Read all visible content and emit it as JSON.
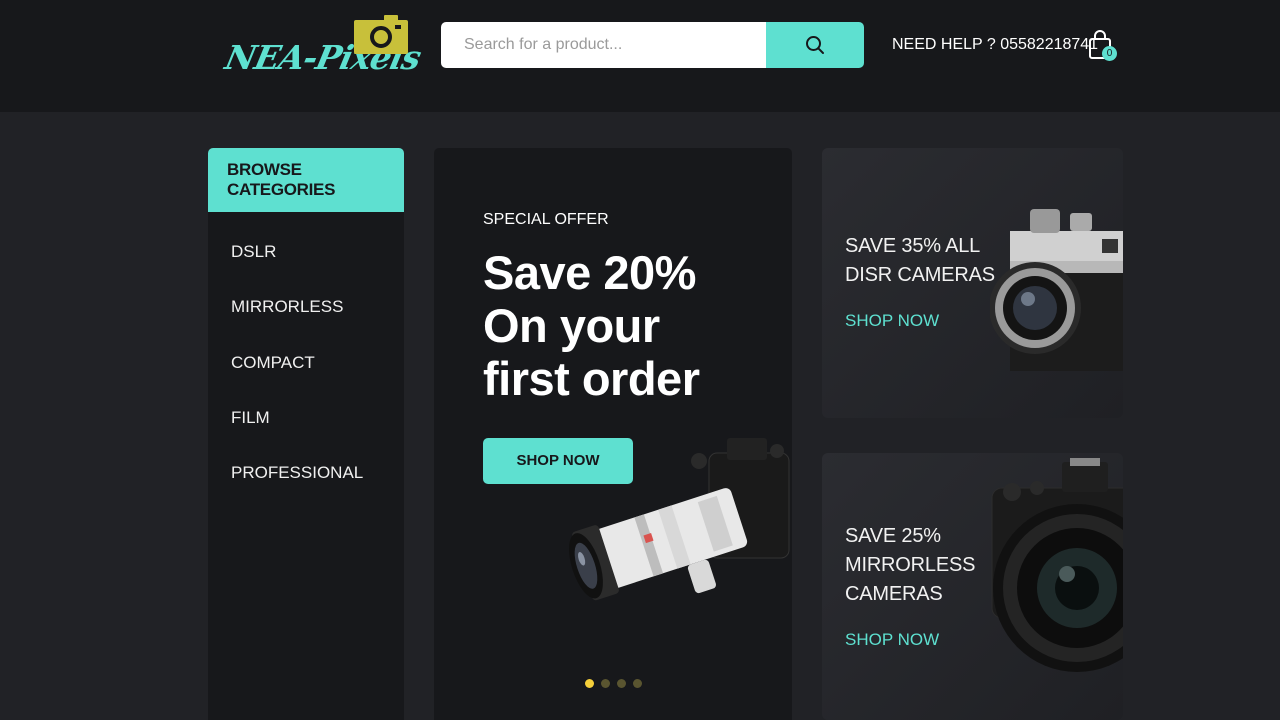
{
  "header": {
    "logo_text": "NEA-Pixels",
    "search": {
      "placeholder": "Search for a product..."
    },
    "help_text": "NEED HELP ? 05582218741",
    "cart_count": "0"
  },
  "sidebar": {
    "title": "BROWSE CATEGORIES",
    "items": [
      {
        "label": "DSLR"
      },
      {
        "label": "MIRRORLESS"
      },
      {
        "label": "COMPACT"
      },
      {
        "label": "FILM"
      },
      {
        "label": "PROFESSIONAL"
      }
    ]
  },
  "hero": {
    "kicker": "SPECIAL OFFER",
    "title_line1": "Save 20%",
    "title_line2": "On your",
    "title_line3": "first order",
    "button_label": "SHOP NOW",
    "slides_total": 4,
    "active_slide": 1
  },
  "promos": [
    {
      "title_line1": "SAVE 35% ALL",
      "title_line2": "DISR CAMERAS",
      "link_label": "SHOP NOW"
    },
    {
      "title_line1": "SAVE 25%",
      "title_line2": "MIRRORLESS",
      "title_line3": "CAMERAS",
      "link_label": "SHOP NOW"
    }
  ],
  "colors": {
    "accent": "#5ee0d0",
    "header_bg": "#17181b",
    "page_bg": "#212226",
    "logo_camera": "#c8c03a",
    "dot_active": "#f5cf3a"
  }
}
